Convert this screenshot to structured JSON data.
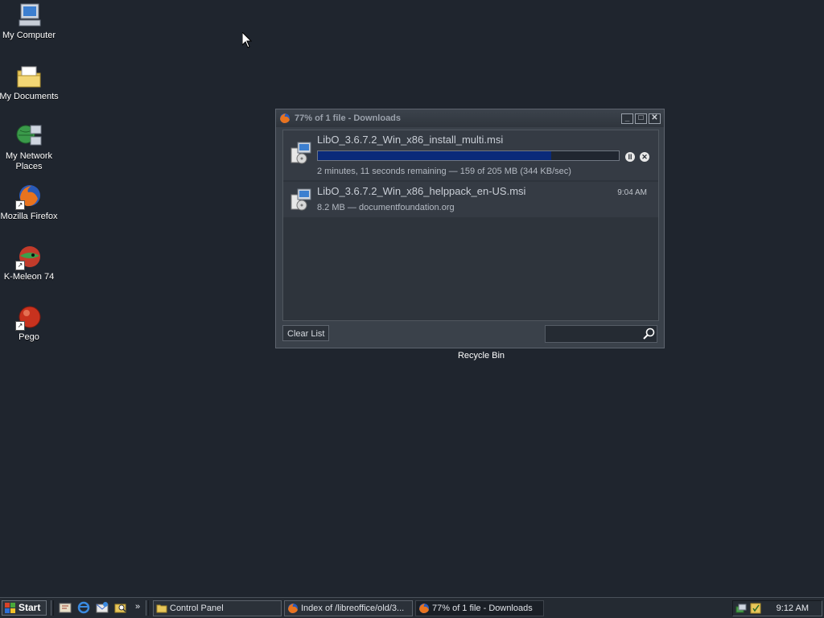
{
  "desktop": {
    "icons": [
      {
        "label": "My Computer",
        "icon": "my-computer-icon"
      },
      {
        "label": "My Documents",
        "icon": "my-documents-icon"
      },
      {
        "label": "My Network Places",
        "icon": "network-places-icon"
      },
      {
        "label": "Mozilla Firefox",
        "icon": "firefox-icon"
      },
      {
        "label": "K-Meleon 74",
        "icon": "k-meleon-icon"
      },
      {
        "label": "Pego",
        "icon": "pego-icon"
      }
    ],
    "recycle_bin_label": "Recycle Bin"
  },
  "downloads_window": {
    "title": "77% of 1 file - Downloads",
    "items": [
      {
        "filename": "LibO_3.6.7.2_Win_x86_install_multi.msi",
        "status": "2 minutes, 11 seconds remaining — 159 of 205 MB (344 KB/sec)",
        "progress": 0.775,
        "state": "downloading"
      },
      {
        "filename": "LibO_3.6.7.2_Win_x86_helppack_en-US.msi",
        "status": "8.2 MB — documentfoundation.org",
        "time": "9:04 AM",
        "state": "complete"
      }
    ],
    "clear_list_label": "Clear List",
    "search_value": ""
  },
  "taskbar": {
    "start_label": "Start",
    "tasks": [
      {
        "label": "Control Panel",
        "icon": "folder-icon",
        "active": false
      },
      {
        "label": "Index of /libreoffice/old/3...",
        "icon": "firefox-icon",
        "active": false
      },
      {
        "label": "77% of 1 file - Downloads",
        "icon": "firefox-icon",
        "active": true
      }
    ],
    "clock": "9:12 AM"
  },
  "colors": {
    "desktop_bg": "#1f252e",
    "progress_fill": "#0a2a7a"
  }
}
